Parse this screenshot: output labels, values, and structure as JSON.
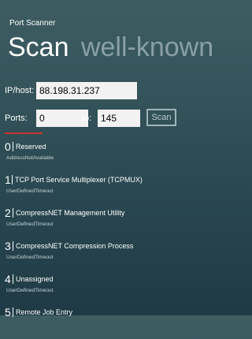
{
  "app": {
    "title": "Port Scanner"
  },
  "pivot": {
    "active": "Scan",
    "inactive": "well-known"
  },
  "form": {
    "ip_label": "IP/host:",
    "ip_value": "88.198.31.237",
    "ports_label": "Ports:",
    "ports_from": "0",
    "to_label": "to:",
    "ports_to": "145",
    "scan_label": "Scan"
  },
  "progress": {
    "fraction": 0.2
  },
  "results": [
    {
      "port": "0",
      "name": "Reserved",
      "status": "AddressNotAvailable"
    },
    {
      "port": "1",
      "name": "TCP Port Service Multiplexer (TCPMUX)",
      "status": "UserDefinedTimeout"
    },
    {
      "port": "2",
      "name": "CompressNET Management Utility",
      "status": "UserDefinedTimeout"
    },
    {
      "port": "3",
      "name": "CompressNET Compression Process",
      "status": "UserDefinedTimeout"
    },
    {
      "port": "4",
      "name": "Unassigned",
      "status": "UserDefinedTimeout"
    },
    {
      "port": "5",
      "name": "Remote Job Entry",
      "status": ""
    }
  ]
}
